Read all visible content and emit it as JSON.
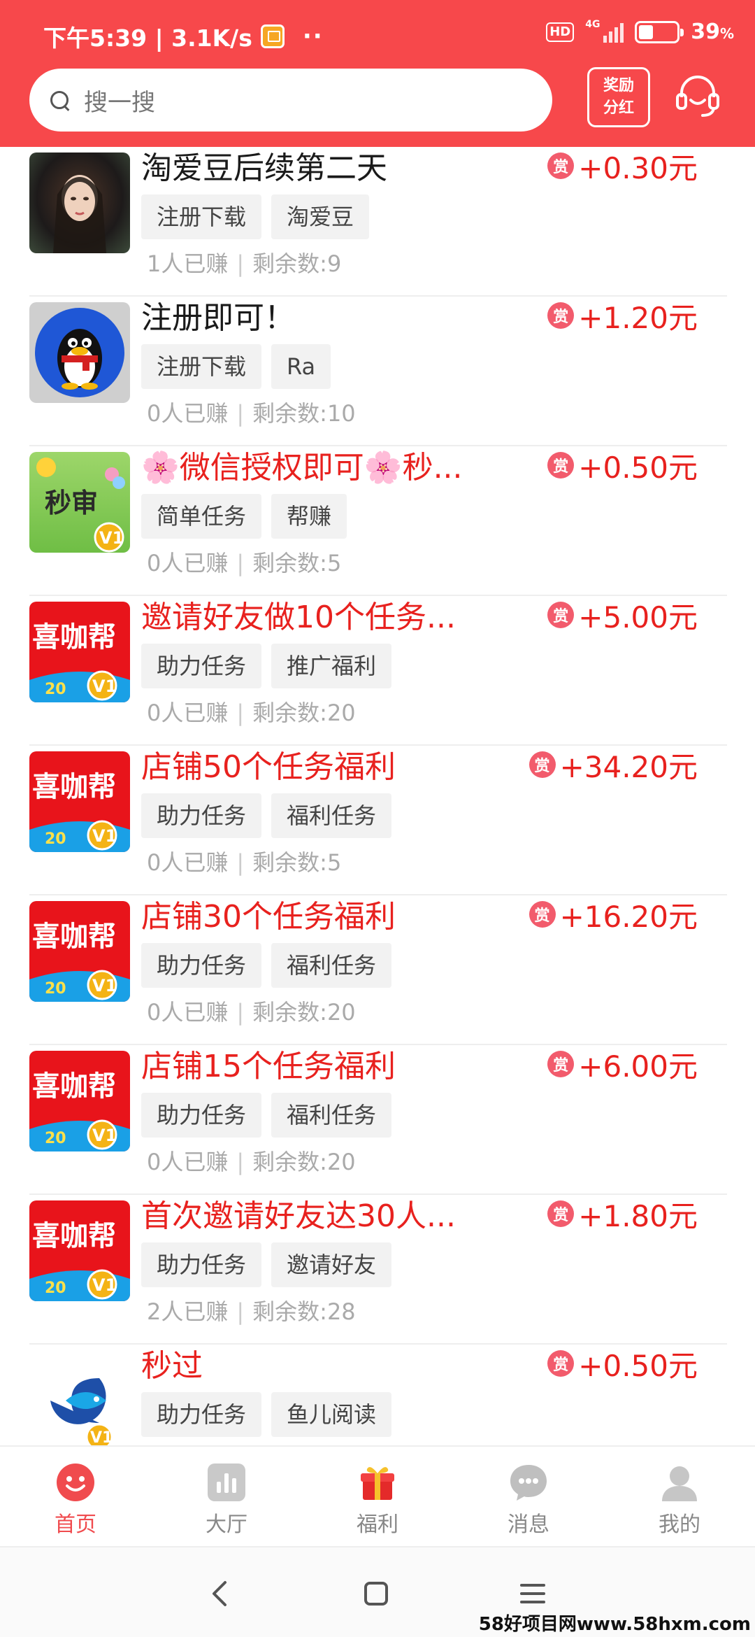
{
  "status_bar": {
    "time_speed": "下午5:39 | 3.1K/s",
    "dots": "··",
    "hd": "HD",
    "network": "4G",
    "battery": "39",
    "battery_unit": "%"
  },
  "search": {
    "placeholder": "搜一搜"
  },
  "reward_button": {
    "line1": "奖励",
    "line2": "分红"
  },
  "colors": {
    "header": "#f7484b",
    "accent_red": "#e8211e",
    "tag_bg": "#f2f2f2"
  },
  "tasks": [
    {
      "title": "淘爱豆后续第二天",
      "title_color": "black",
      "reward": "+0.30元",
      "tags": [
        "注册下载",
        "淘爱豆"
      ],
      "earned": "1人已赚",
      "remaining": "剩余数:9",
      "thumb": "portrait-photo"
    },
    {
      "title": "注册即可！",
      "title_color": "black",
      "reward": "+1.20元",
      "tags": [
        "注册下载",
        "Ra"
      ],
      "earned": "0人已赚",
      "remaining": "剩余数:10",
      "thumb": "qq-penguin"
    },
    {
      "title": "🌸微信授权即可🌸秒...",
      "title_color": "red",
      "reward": "+0.50元",
      "tags": [
        "简单任务",
        "帮赚"
      ],
      "earned": "0人已赚",
      "remaining": "剩余数:5",
      "thumb": "miaoshen-logo",
      "thumb_text": "秒审"
    },
    {
      "title": "邀请好友做10个任务...",
      "title_color": "red",
      "reward": "+5.00元",
      "tags": [
        "助力任务",
        "推广福利"
      ],
      "earned": "0人已赚",
      "remaining": "剩余数:20",
      "thumb": "xikabang-logo",
      "thumb_text": "喜咖帮"
    },
    {
      "title": "店铺50个任务福利",
      "title_color": "red",
      "reward": "+34.20元",
      "tags": [
        "助力任务",
        "福利任务"
      ],
      "earned": "0人已赚",
      "remaining": "剩余数:5",
      "thumb": "xikabang-logo",
      "thumb_text": "喜咖帮"
    },
    {
      "title": "店铺30个任务福利",
      "title_color": "red",
      "reward": "+16.20元",
      "tags": [
        "助力任务",
        "福利任务"
      ],
      "earned": "0人已赚",
      "remaining": "剩余数:20",
      "thumb": "xikabang-logo",
      "thumb_text": "喜咖帮"
    },
    {
      "title": "店铺15个任务福利",
      "title_color": "red",
      "reward": "+6.00元",
      "tags": [
        "助力任务",
        "福利任务"
      ],
      "earned": "0人已赚",
      "remaining": "剩余数:20",
      "thumb": "xikabang-logo",
      "thumb_text": "喜咖帮"
    },
    {
      "title": "首次邀请好友达30人...",
      "title_color": "red",
      "reward": "+1.80元",
      "tags": [
        "助力任务",
        "邀请好友"
      ],
      "earned": "2人已赚",
      "remaining": "剩余数:28",
      "thumb": "xikabang-logo",
      "thumb_text": "喜咖帮"
    },
    {
      "title": "秒过",
      "title_color": "red",
      "reward": "+0.50元",
      "tags": [
        "助力任务",
        "鱼儿阅读"
      ],
      "earned": "",
      "remaining": "",
      "thumb": "fish-logo"
    }
  ],
  "reward_badge": "赏",
  "v1_badge": "V1",
  "badge_number": "20",
  "tabs": [
    {
      "label": "首页",
      "icon": "smile-icon",
      "active": true
    },
    {
      "label": "大厅",
      "icon": "bar-chart-icon",
      "active": false
    },
    {
      "label": "福利",
      "icon": "gift-icon",
      "active": false
    },
    {
      "label": "消息",
      "icon": "chat-icon",
      "active": false
    },
    {
      "label": "我的",
      "icon": "user-icon",
      "active": false
    }
  ],
  "watermark": "58好项目网www.58hxm.com"
}
